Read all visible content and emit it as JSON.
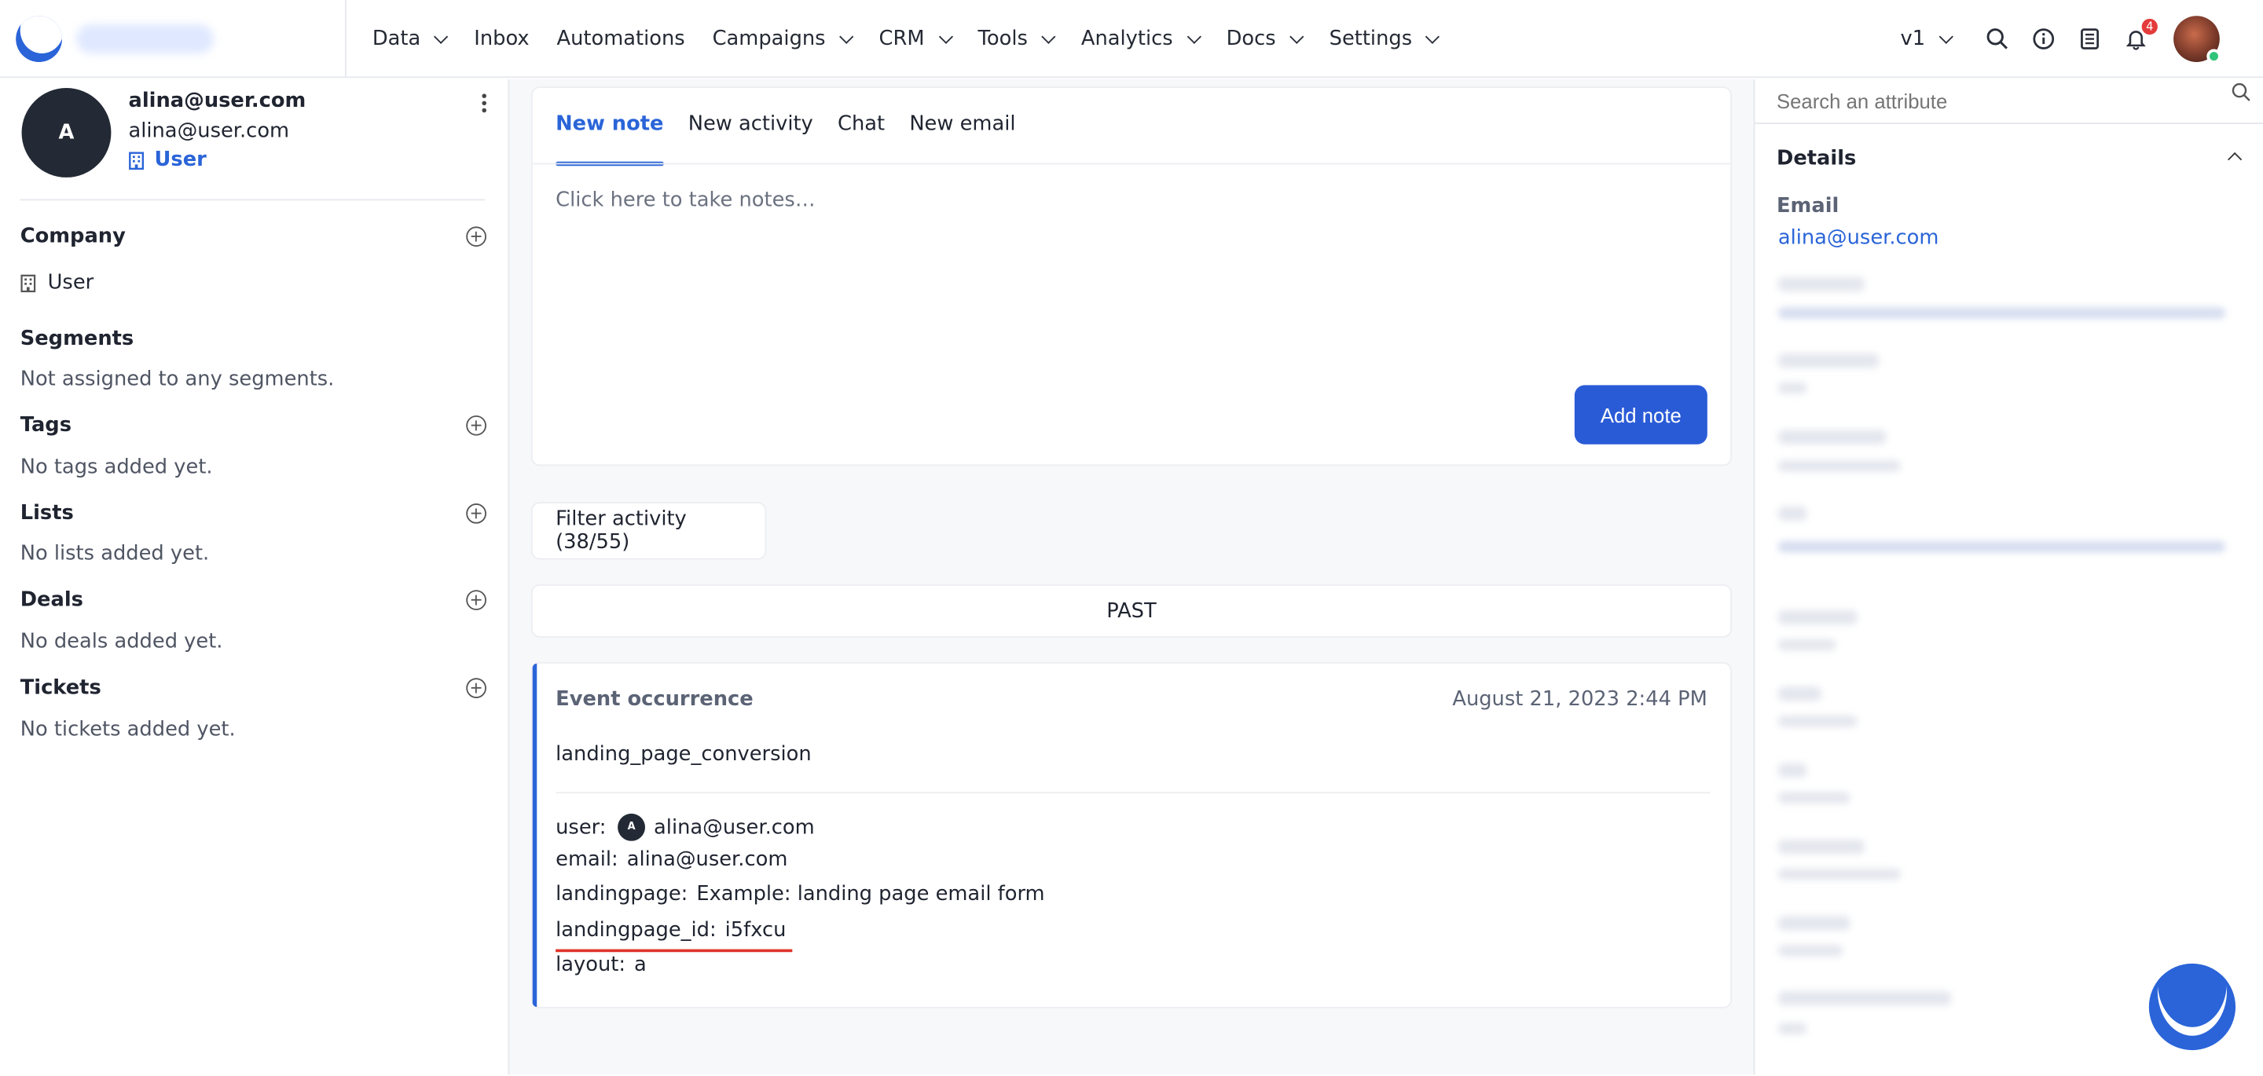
{
  "nav": {
    "items": [
      {
        "label": "Data",
        "dropdown": true
      },
      {
        "label": "Inbox",
        "dropdown": false
      },
      {
        "label": "Automations",
        "dropdown": false
      },
      {
        "label": "Campaigns",
        "dropdown": true
      },
      {
        "label": "CRM",
        "dropdown": true
      },
      {
        "label": "Tools",
        "dropdown": true
      },
      {
        "label": "Analytics",
        "dropdown": true
      },
      {
        "label": "Docs",
        "dropdown": true
      },
      {
        "label": "Settings",
        "dropdown": true
      }
    ],
    "version": "v1",
    "notifications_count": "4",
    "icons": [
      "search-icon",
      "info-icon",
      "book-icon",
      "bell-icon"
    ]
  },
  "profile": {
    "initial": "A",
    "name": "alina@user.com",
    "email": "alina@user.com",
    "company_link": "User"
  },
  "sections": {
    "company": {
      "title": "Company",
      "value": "User"
    },
    "segments": {
      "title": "Segments",
      "empty": "Not assigned to any segments."
    },
    "tags": {
      "title": "Tags",
      "empty": "No tags added yet."
    },
    "lists": {
      "title": "Lists",
      "empty": "No lists added yet."
    },
    "deals": {
      "title": "Deals",
      "empty": "No deals added yet."
    },
    "tickets": {
      "title": "Tickets",
      "empty": "No tickets added yet."
    }
  },
  "composer": {
    "tabs": [
      "New note",
      "New activity",
      "Chat",
      "New email"
    ],
    "active_tab": "New note",
    "placeholder": "Click here to take notes…",
    "add_button": "Add note"
  },
  "activity": {
    "filter_label": "Filter activity (38/55)",
    "divider": "PAST",
    "event": {
      "type": "Event occurrence",
      "timestamp": "August 21, 2023 2:44 PM",
      "name": "landing_page_conversion",
      "fields": {
        "user_key": "user:",
        "user_initial": "A",
        "user_value": "alina@user.com",
        "email_key": "email:",
        "email_value": "alina@user.com",
        "landingpage_key": "landingpage:",
        "landingpage_value": "Example: landing page email form",
        "landingpage_id_key": "landingpage_id:",
        "landingpage_id_value": "i5fxcu",
        "layout_key": "layout:",
        "layout_value": "a"
      }
    }
  },
  "attributes": {
    "search_placeholder": "Search an attribute",
    "details_title": "Details",
    "email_label": "Email",
    "email_value": "alina@user.com"
  },
  "colors": {
    "accent": "#2a64d8",
    "highlight_underline": "#e0342b",
    "notification": "#e43b3b"
  }
}
